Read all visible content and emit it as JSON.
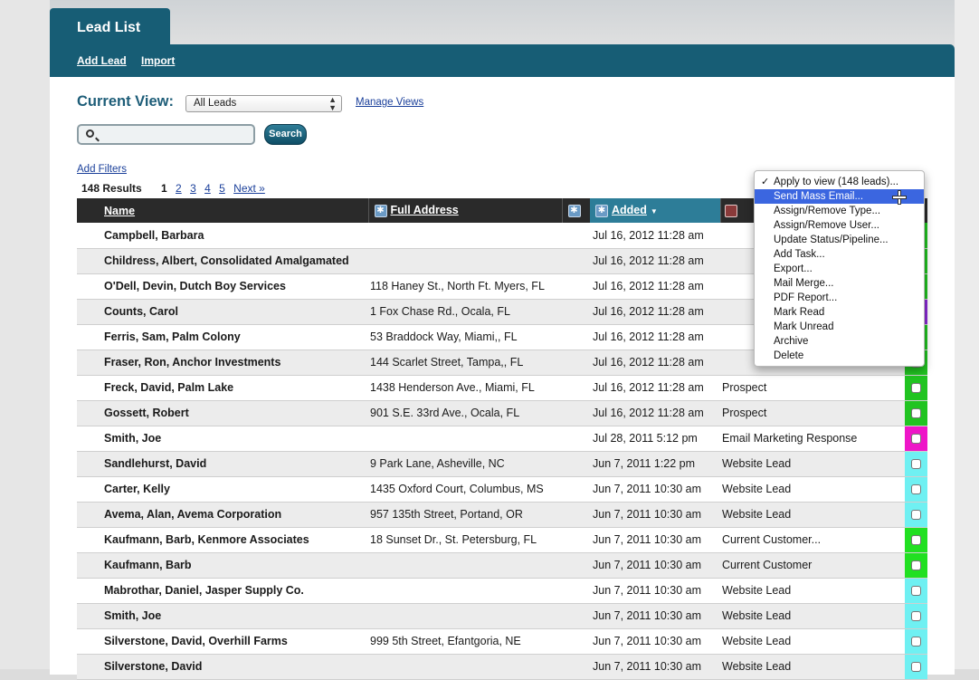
{
  "tab": {
    "label": "Lead List"
  },
  "toolbar": {
    "add_lead": "Add Lead",
    "import": "Import"
  },
  "view": {
    "label": "Current View:",
    "selected": "All Leads",
    "manage": "Manage Views"
  },
  "search": {
    "placeholder": "",
    "button": "Search"
  },
  "filters": {
    "add": "Add Filters"
  },
  "results": {
    "text": "148 Results",
    "pages": [
      "1",
      "2",
      "3",
      "4",
      "5"
    ],
    "next": "Next »"
  },
  "columns": {
    "name": "Name",
    "address": "Full Address",
    "added": "Added"
  },
  "menu": [
    {
      "label": "Apply to view (148 leads)...",
      "checked": true
    },
    {
      "label": "Send Mass Email...",
      "highlighted": true
    },
    {
      "label": "Assign/Remove Type..."
    },
    {
      "label": "Assign/Remove User..."
    },
    {
      "label": "Update Status/Pipeline..."
    },
    {
      "label": "Add Task..."
    },
    {
      "label": "Export..."
    },
    {
      "label": "Mail Merge..."
    },
    {
      "label": "PDF Report..."
    },
    {
      "label": "Mark Read"
    },
    {
      "label": "Mark Unread"
    },
    {
      "label": "Archive"
    },
    {
      "label": "Delete"
    }
  ],
  "rows": [
    {
      "name": "Campbell, Barbara",
      "address": "",
      "added": "Jul 16, 2012 11:28 am",
      "type": "",
      "color": "#21c421"
    },
    {
      "name": "Childress, Albert, Consolidated Amalgamated",
      "address": "",
      "added": "Jul 16, 2012 11:28 am",
      "type": "",
      "color": "#21c421"
    },
    {
      "name": "O'Dell, Devin, Dutch Boy Services",
      "address": "118 Haney St., North Ft. Myers, FL",
      "added": "Jul 16, 2012 11:28 am",
      "type": "",
      "color": "#21c421"
    },
    {
      "name": "Counts, Carol",
      "address": "1 Fox Chase Rd., Ocala, FL",
      "added": "Jul 16, 2012 11:28 am",
      "type": "",
      "color": "#8a2ad6"
    },
    {
      "name": "Ferris, Sam, Palm Colony",
      "address": "53 Braddock Way, Miami,, FL",
      "added": "Jul 16, 2012 11:28 am",
      "type": "",
      "color": "#21c421"
    },
    {
      "name": "Fraser, Ron, Anchor Investments",
      "address": "144 Scarlet Street, Tampa,, FL",
      "added": "Jul 16, 2012 11:28 am",
      "type": "",
      "color": "#21c421"
    },
    {
      "name": "Freck, David, Palm Lake",
      "address": "1438 Henderson Ave., Miami, FL",
      "added": "Jul 16, 2012 11:28 am",
      "type": "Prospect",
      "color": "#21c421"
    },
    {
      "name": "Gossett, Robert",
      "address": "901 S.E. 33rd Ave., Ocala, FL",
      "added": "Jul 16, 2012 11:28 am",
      "type": "Prospect",
      "color": "#21c421"
    },
    {
      "name": "Smith, Joe",
      "address": "",
      "added": "Jul 28, 2011 5:12 pm",
      "type": "Email Marketing Response",
      "color": "#ee16c8"
    },
    {
      "name": "Sandlehurst, David",
      "address": "9 Park Lane, Asheville, NC",
      "added": "Jun 7, 2011 1:22 pm",
      "type": "Website Lead",
      "color": "#6ff0f2"
    },
    {
      "name": "Carter, Kelly",
      "address": "1435 Oxford Court, Columbus, MS",
      "added": "Jun 7, 2011 10:30 am",
      "type": "Website Lead",
      "color": "#6ff0f2"
    },
    {
      "name": "Avema, Alan, Avema Corporation",
      "address": "957 135th Street, Portand, OR",
      "added": "Jun 7, 2011 10:30 am",
      "type": "Website Lead",
      "color": "#6ff0f2"
    },
    {
      "name": "Kaufmann, Barb, Kenmore Associates",
      "address": "18 Sunset Dr., St. Petersburg, FL",
      "added": "Jun 7, 2011 10:30 am",
      "type": "Current Customer...",
      "color": "#21e021"
    },
    {
      "name": "Kaufmann, Barb",
      "address": "",
      "added": "Jun 7, 2011 10:30 am",
      "type": "Current Customer",
      "color": "#21e021"
    },
    {
      "name": "Mabrothar, Daniel, Jasper Supply Co.",
      "address": "",
      "added": "Jun 7, 2011 10:30 am",
      "type": "Website Lead",
      "color": "#6ff0f2"
    },
    {
      "name": "Smith, Joe",
      "address": "",
      "added": "Jun 7, 2011 10:30 am",
      "type": "Website Lead",
      "color": "#6ff0f2"
    },
    {
      "name": "Silverstone, David, Overhill Farms",
      "address": "999 5th Street, Efantgoria, NE",
      "added": "Jun 7, 2011 10:30 am",
      "type": "Website Lead",
      "color": "#6ff0f2"
    },
    {
      "name": "Silverstone, David",
      "address": "",
      "added": "Jun 7, 2011 10:30 am",
      "type": "Website Lead",
      "color": "#6ff0f2"
    }
  ]
}
